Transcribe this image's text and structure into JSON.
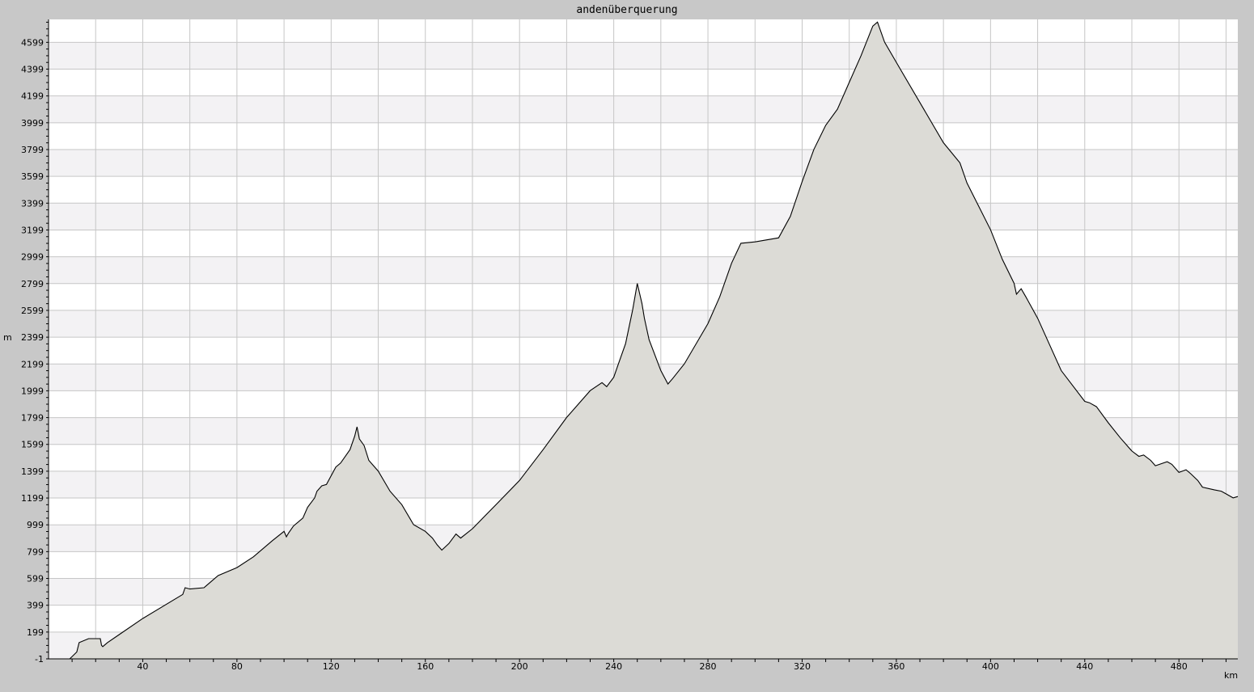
{
  "chart_data": {
    "type": "area",
    "title": "andenüberquerung",
    "xlabel": "km",
    "ylabel": "m",
    "xlim": [
      0,
      505
    ],
    "ylim": [
      -1,
      4770
    ],
    "x_ticks": [
      40,
      80,
      120,
      160,
      200,
      240,
      280,
      320,
      360,
      400,
      440,
      480
    ],
    "y_ticks": [
      -1,
      199,
      399,
      599,
      799,
      999,
      1199,
      1399,
      1599,
      1799,
      1999,
      2199,
      2399,
      2599,
      2799,
      2999,
      3199,
      3399,
      3599,
      3799,
      3999,
      4199,
      4399,
      4599
    ],
    "grid": true,
    "legend": "none",
    "series": [
      {
        "x": [
          0,
          9,
          12,
          13,
          17,
          22,
          22.5,
          23,
          25,
          30,
          40,
          57,
          58,
          60,
          66,
          72,
          80,
          87,
          95,
          100,
          101,
          102,
          104,
          108,
          110,
          113,
          114,
          116,
          118,
          122,
          124,
          128,
          130,
          131,
          132,
          134,
          136,
          138,
          140,
          145,
          150,
          155,
          160,
          163,
          165,
          167,
          170,
          173,
          175,
          180,
          190,
          200,
          210,
          220,
          230,
          235,
          237,
          240,
          242,
          245,
          248,
          250,
          252,
          253,
          255,
          260,
          263,
          265,
          270,
          280,
          285,
          290,
          294,
          300,
          310,
          315,
          320,
          325,
          330,
          335,
          340,
          345,
          350,
          352,
          355,
          360,
          370,
          380,
          387,
          390,
          400,
          405,
          410,
          411,
          413,
          415,
          420,
          430,
          440,
          442,
          445,
          450,
          455,
          460,
          463,
          465,
          468,
          470,
          475,
          477,
          480,
          483,
          485,
          488,
          490,
          495,
          498,
          500,
          503,
          505
        ],
        "y": [
          -1,
          -1,
          50,
          120,
          150,
          150,
          100,
          90,
          120,
          180,
          300,
          480,
          530,
          520,
          530,
          620,
          680,
          760,
          880,
          950,
          910,
          940,
          990,
          1050,
          1130,
          1200,
          1250,
          1290,
          1300,
          1430,
          1460,
          1560,
          1660,
          1730,
          1640,
          1590,
          1480,
          1440,
          1400,
          1250,
          1150,
          1000,
          950,
          900,
          850,
          810,
          860,
          930,
          900,
          970,
          1150,
          1330,
          1560,
          1800,
          2000,
          2060,
          2030,
          2100,
          2200,
          2350,
          2600,
          2800,
          2650,
          2540,
          2380,
          2150,
          2050,
          2090,
          2200,
          2500,
          2700,
          2950,
          3100,
          3110,
          3140,
          3300,
          3560,
          3800,
          3980,
          4100,
          4300,
          4500,
          4720,
          4750,
          4600,
          4450,
          4150,
          3850,
          3700,
          3550,
          3200,
          2980,
          2800,
          2720,
          2760,
          2700,
          2540,
          2150,
          1920,
          1910,
          1880,
          1760,
          1650,
          1550,
          1510,
          1520,
          1480,
          1440,
          1470,
          1450,
          1390,
          1410,
          1380,
          1330,
          1280,
          1260,
          1250,
          1230,
          1200,
          1210
        ]
      }
    ]
  }
}
